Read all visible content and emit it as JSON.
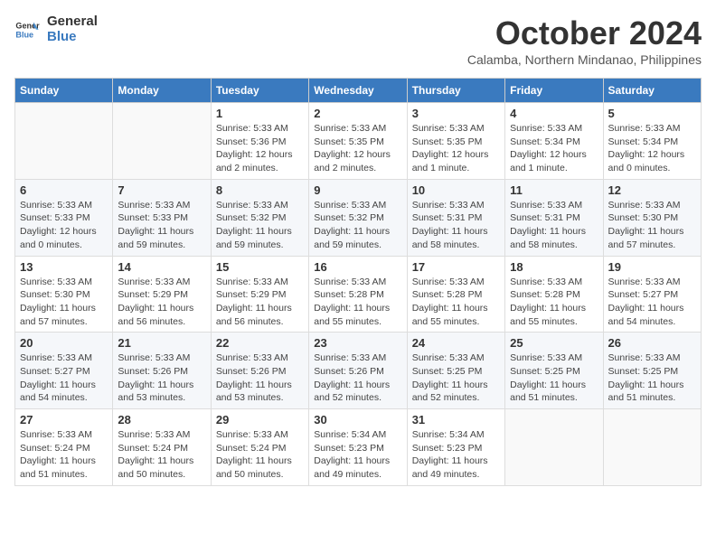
{
  "logo": {
    "line1": "General",
    "line2": "Blue"
  },
  "title": "October 2024",
  "subtitle": "Calamba, Northern Mindanao, Philippines",
  "days_of_week": [
    "Sunday",
    "Monday",
    "Tuesday",
    "Wednesday",
    "Thursday",
    "Friday",
    "Saturday"
  ],
  "weeks": [
    [
      {
        "day": "",
        "info": ""
      },
      {
        "day": "",
        "info": ""
      },
      {
        "day": "1",
        "info": "Sunrise: 5:33 AM\nSunset: 5:36 PM\nDaylight: 12 hours and 2 minutes."
      },
      {
        "day": "2",
        "info": "Sunrise: 5:33 AM\nSunset: 5:35 PM\nDaylight: 12 hours and 2 minutes."
      },
      {
        "day": "3",
        "info": "Sunrise: 5:33 AM\nSunset: 5:35 PM\nDaylight: 12 hours and 1 minute."
      },
      {
        "day": "4",
        "info": "Sunrise: 5:33 AM\nSunset: 5:34 PM\nDaylight: 12 hours and 1 minute."
      },
      {
        "day": "5",
        "info": "Sunrise: 5:33 AM\nSunset: 5:34 PM\nDaylight: 12 hours and 0 minutes."
      }
    ],
    [
      {
        "day": "6",
        "info": "Sunrise: 5:33 AM\nSunset: 5:33 PM\nDaylight: 12 hours and 0 minutes."
      },
      {
        "day": "7",
        "info": "Sunrise: 5:33 AM\nSunset: 5:33 PM\nDaylight: 11 hours and 59 minutes."
      },
      {
        "day": "8",
        "info": "Sunrise: 5:33 AM\nSunset: 5:32 PM\nDaylight: 11 hours and 59 minutes."
      },
      {
        "day": "9",
        "info": "Sunrise: 5:33 AM\nSunset: 5:32 PM\nDaylight: 11 hours and 59 minutes."
      },
      {
        "day": "10",
        "info": "Sunrise: 5:33 AM\nSunset: 5:31 PM\nDaylight: 11 hours and 58 minutes."
      },
      {
        "day": "11",
        "info": "Sunrise: 5:33 AM\nSunset: 5:31 PM\nDaylight: 11 hours and 58 minutes."
      },
      {
        "day": "12",
        "info": "Sunrise: 5:33 AM\nSunset: 5:30 PM\nDaylight: 11 hours and 57 minutes."
      }
    ],
    [
      {
        "day": "13",
        "info": "Sunrise: 5:33 AM\nSunset: 5:30 PM\nDaylight: 11 hours and 57 minutes."
      },
      {
        "day": "14",
        "info": "Sunrise: 5:33 AM\nSunset: 5:29 PM\nDaylight: 11 hours and 56 minutes."
      },
      {
        "day": "15",
        "info": "Sunrise: 5:33 AM\nSunset: 5:29 PM\nDaylight: 11 hours and 56 minutes."
      },
      {
        "day": "16",
        "info": "Sunrise: 5:33 AM\nSunset: 5:28 PM\nDaylight: 11 hours and 55 minutes."
      },
      {
        "day": "17",
        "info": "Sunrise: 5:33 AM\nSunset: 5:28 PM\nDaylight: 11 hours and 55 minutes."
      },
      {
        "day": "18",
        "info": "Sunrise: 5:33 AM\nSunset: 5:28 PM\nDaylight: 11 hours and 55 minutes."
      },
      {
        "day": "19",
        "info": "Sunrise: 5:33 AM\nSunset: 5:27 PM\nDaylight: 11 hours and 54 minutes."
      }
    ],
    [
      {
        "day": "20",
        "info": "Sunrise: 5:33 AM\nSunset: 5:27 PM\nDaylight: 11 hours and 54 minutes."
      },
      {
        "day": "21",
        "info": "Sunrise: 5:33 AM\nSunset: 5:26 PM\nDaylight: 11 hours and 53 minutes."
      },
      {
        "day": "22",
        "info": "Sunrise: 5:33 AM\nSunset: 5:26 PM\nDaylight: 11 hours and 53 minutes."
      },
      {
        "day": "23",
        "info": "Sunrise: 5:33 AM\nSunset: 5:26 PM\nDaylight: 11 hours and 52 minutes."
      },
      {
        "day": "24",
        "info": "Sunrise: 5:33 AM\nSunset: 5:25 PM\nDaylight: 11 hours and 52 minutes."
      },
      {
        "day": "25",
        "info": "Sunrise: 5:33 AM\nSunset: 5:25 PM\nDaylight: 11 hours and 51 minutes."
      },
      {
        "day": "26",
        "info": "Sunrise: 5:33 AM\nSunset: 5:25 PM\nDaylight: 11 hours and 51 minutes."
      }
    ],
    [
      {
        "day": "27",
        "info": "Sunrise: 5:33 AM\nSunset: 5:24 PM\nDaylight: 11 hours and 51 minutes."
      },
      {
        "day": "28",
        "info": "Sunrise: 5:33 AM\nSunset: 5:24 PM\nDaylight: 11 hours and 50 minutes."
      },
      {
        "day": "29",
        "info": "Sunrise: 5:33 AM\nSunset: 5:24 PM\nDaylight: 11 hours and 50 minutes."
      },
      {
        "day": "30",
        "info": "Sunrise: 5:34 AM\nSunset: 5:23 PM\nDaylight: 11 hours and 49 minutes."
      },
      {
        "day": "31",
        "info": "Sunrise: 5:34 AM\nSunset: 5:23 PM\nDaylight: 11 hours and 49 minutes."
      },
      {
        "day": "",
        "info": ""
      },
      {
        "day": "",
        "info": ""
      }
    ]
  ]
}
